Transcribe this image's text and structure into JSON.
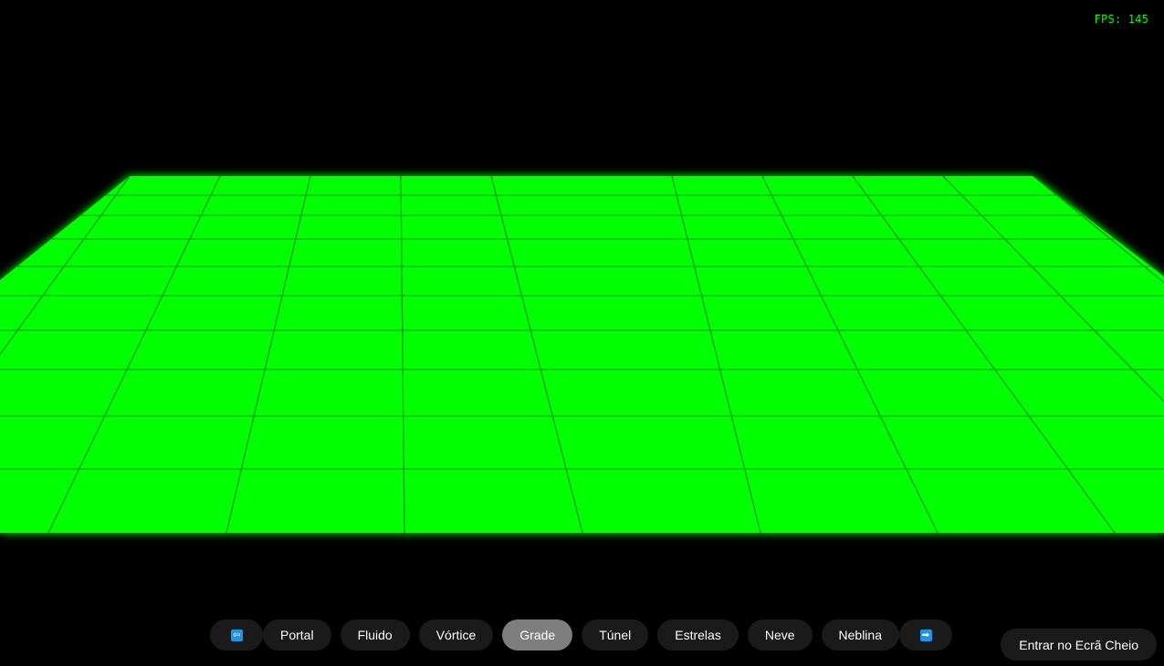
{
  "hud": {
    "fps": "FPS: 145"
  },
  "scene": {
    "floor_color": "#00ff00",
    "grid_line_color": "#009b00",
    "background": "#000000"
  },
  "nav": {
    "prev_icon": "left-arrow-icon",
    "prev_glyph": "⇦",
    "next_icon": "right-arrow-icon",
    "next_glyph": "➡",
    "items": [
      {
        "label": "Portal",
        "active": false
      },
      {
        "label": "Fluido",
        "active": false
      },
      {
        "label": "Vórtice",
        "active": false
      },
      {
        "label": "Grade",
        "active": true
      },
      {
        "label": "Túnel",
        "active": false
      },
      {
        "label": "Estrelas",
        "active": false
      },
      {
        "label": "Neve",
        "active": false
      },
      {
        "label": "Neblina",
        "active": false
      }
    ]
  },
  "fullscreen": {
    "label": "Entrar no Ecrã Cheio"
  },
  "colors": {
    "button_bg": "#1a1a1a",
    "button_active_bg": "#7e7e7e",
    "accent_arrow": "#1c96e8",
    "hud_text": "#00ff00"
  }
}
